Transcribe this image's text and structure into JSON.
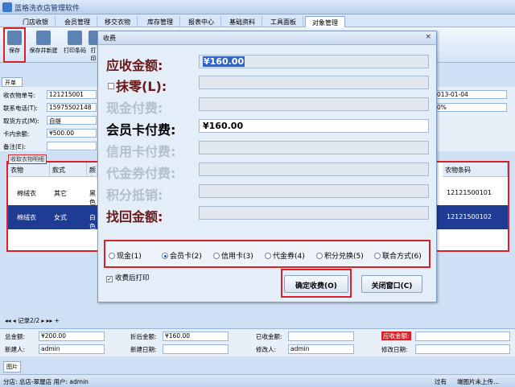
{
  "app": {
    "title": "蓝格洗衣店管理软件"
  },
  "menu": {
    "tabs": [
      "门店收银",
      "会员管理",
      "移交衣物",
      "库存管理",
      "报表中心",
      "基础资料",
      "工具面板",
      "对象管理"
    ]
  },
  "toolbar": {
    "buttons": [
      "保存",
      "保存并新建",
      "打印条码",
      "打印"
    ]
  },
  "doc": {
    "tab": "开单"
  },
  "form": {
    "receipt_no_label": "收衣物单号:",
    "receipt_no": "121215001",
    "phone_label": "联系电话(T):",
    "phone": "15975502148",
    "pickup_label": "取货方式(M):",
    "pickup": "自提",
    "card_label": "卡内余额:",
    "card": "¥500.00",
    "note_label": "备注(E):",
    "date_right": "013-01-04",
    "percent_right": "0%"
  },
  "grid": {
    "tab": "收取衣物明细",
    "headers": [
      "衣物",
      "款式",
      "颜色",
      "衣物条码"
    ],
    "rows": [
      {
        "item": "棉绒衣",
        "style": "其它",
        "color": "黑色",
        "code": "12121500101"
      },
      {
        "item": "棉绒衣",
        "style": "女式",
        "color": "白色",
        "code": "12121500102"
      }
    ]
  },
  "pager": {
    "text": "记录2/2"
  },
  "summary": {
    "total_label": "总金额:",
    "total": "¥200.00",
    "discount_label": "折后金额:",
    "discount": "¥160.00",
    "paid_label": "已收金额:",
    "due_label": "应收金额:",
    "creator_label": "新建人:",
    "creator": "admin",
    "created_label": "新建日期:",
    "modifier_label": "修改人:",
    "modifier": "admin",
    "modified_label": "修改日期:"
  },
  "bottom": {
    "img_tab": "图片",
    "status": "分店: 总店-翠屋店  用户: admin",
    "right1": "过有",
    "right2": "端图片未上传..."
  },
  "dialog": {
    "title": "收费",
    "close": "×",
    "due_label": "应收金额:",
    "due_value": "¥160.00",
    "round_label": "抹零(L):",
    "cash_label": "现金付费:",
    "member_label": "会员卡付费:",
    "member_value": "¥160.00",
    "credit_label": "信用卡付费:",
    "voucher_label": "代金券付费:",
    "points_label": "积分抵销:",
    "change_label": "找回金额:",
    "options": [
      "现金(1)",
      "会员卡(2)",
      "信用卡(3)",
      "代金券(4)",
      "积分兑换(5)",
      "联合方式(6)"
    ],
    "selected_option": "会员卡(2)",
    "print_after": "收费后打印",
    "confirm": "确定收费(O)",
    "close_window": "关闭窗口(C)"
  },
  "colors": {
    "highlight": "#d7222a",
    "selected_row": "#1f3c95",
    "accent": "#3163c5"
  }
}
